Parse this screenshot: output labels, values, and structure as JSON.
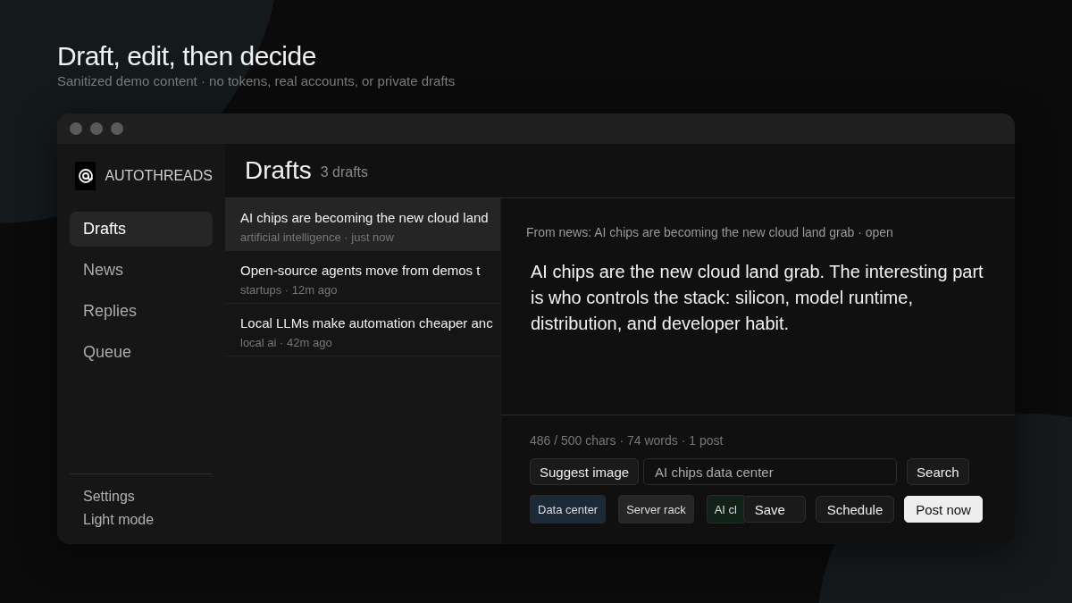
{
  "page": {
    "title": "Draft, edit, then decide",
    "subtitle": "Sanitized demo content · no tokens, real accounts, or private drafts"
  },
  "sidebar": {
    "brand": "AUTOTHREADS",
    "items": [
      {
        "label": "Drafts",
        "selected": true
      },
      {
        "label": "News",
        "selected": false
      },
      {
        "label": "Replies",
        "selected": false
      },
      {
        "label": "Queue",
        "selected": false
      }
    ],
    "footer": [
      "Settings",
      "Light mode"
    ]
  },
  "header": {
    "title": "Drafts",
    "count": "3 drafts"
  },
  "drafts": [
    {
      "title": "AI chips are becoming the new cloud land",
      "meta": "artificial intelligence · just now",
      "selected": true
    },
    {
      "title": "Open-source agents move from demos t",
      "meta": "startups · 12m ago",
      "selected": false
    },
    {
      "title": "Local LLMs make automation cheaper anc",
      "meta": "local ai · 42m ago",
      "selected": false
    }
  ],
  "editor": {
    "source": "From news: AI chips are becoming the new cloud land grab · open",
    "body": "AI chips are the new cloud land grab. The interesting part is who controls the stack: silicon, model runtime, distribution, and developer habit.",
    "stats": "486 / 500 chars · 74 words · 1 post"
  },
  "image_search": {
    "button": "Suggest image",
    "value": "AI chips data center",
    "search": "Search"
  },
  "chips": [
    {
      "label": "Data center",
      "color": "#1c2a38"
    },
    {
      "label": "Server rack",
      "color": "#262626"
    },
    {
      "label": "AI cl",
      "color": "#10211a"
    }
  ],
  "actions": [
    {
      "label": "Save",
      "kind": "secondary"
    },
    {
      "label": "Schedule",
      "kind": "secondary"
    },
    {
      "label": "Post now",
      "kind": "primary"
    }
  ]
}
